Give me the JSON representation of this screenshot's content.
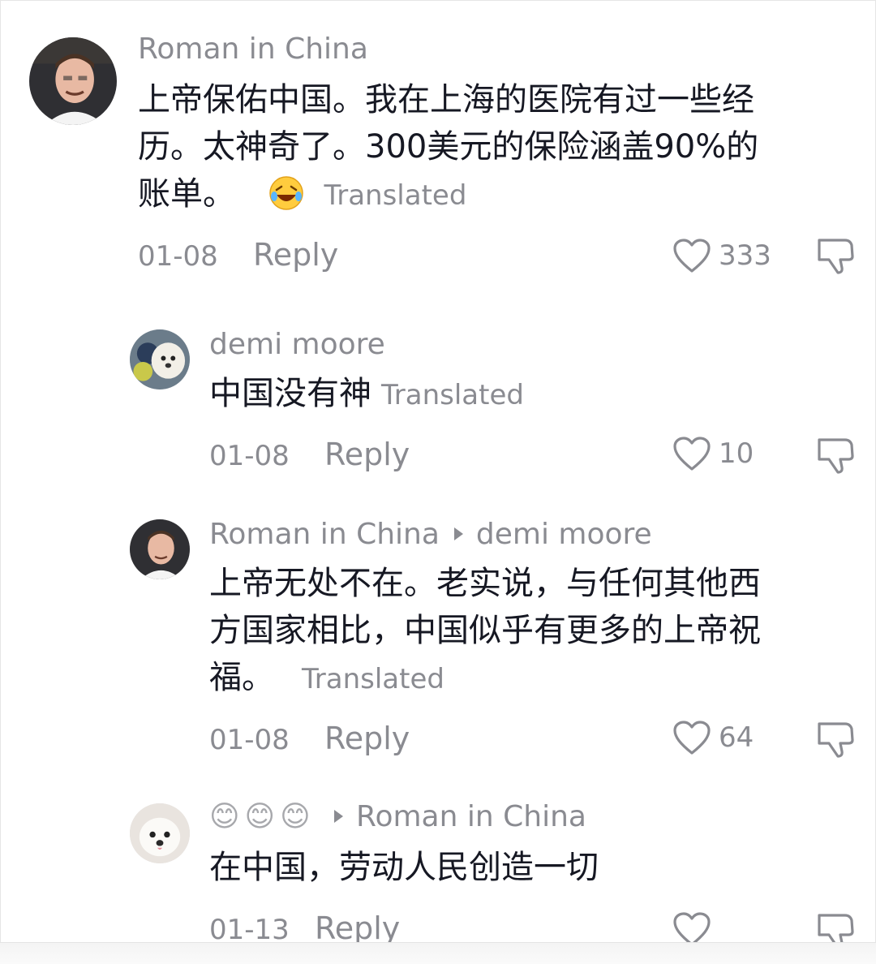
{
  "comments": [
    {
      "author": "Roman in China",
      "text_lines": [
        "上帝保佑中国。我在上海的医院有过一些经",
        "历。太神奇了。300美元的保险涵盖90%的",
        "账单。"
      ],
      "emoji": "laughing-face",
      "translated": "Translated",
      "date": "01-08",
      "reply": "Reply",
      "likes": "333"
    },
    {
      "author": "demi moore",
      "text_lines": [
        "中国没有神"
      ],
      "translated": "Translated",
      "date": "01-08",
      "reply": "Reply",
      "likes": "10"
    },
    {
      "author": "Roman in China",
      "reply_to": "demi moore",
      "text_lines": [
        "上帝无处不在。老实说，与任何其他西",
        "方国家相比，中国似乎有更多的上帝祝",
        "福。"
      ],
      "translated": "Translated",
      "date": "01-08",
      "reply": "Reply",
      "likes": "64"
    },
    {
      "author_emoji": [
        "😊",
        "😊",
        "😊"
      ],
      "reply_to": "Roman in China",
      "text_lines": [
        "在中国，劳动人民创造一切"
      ],
      "date": "01-13",
      "reply": "Reply"
    }
  ],
  "colors": {
    "meta_gray": "#8a8b91",
    "text_dark": "#161823"
  }
}
